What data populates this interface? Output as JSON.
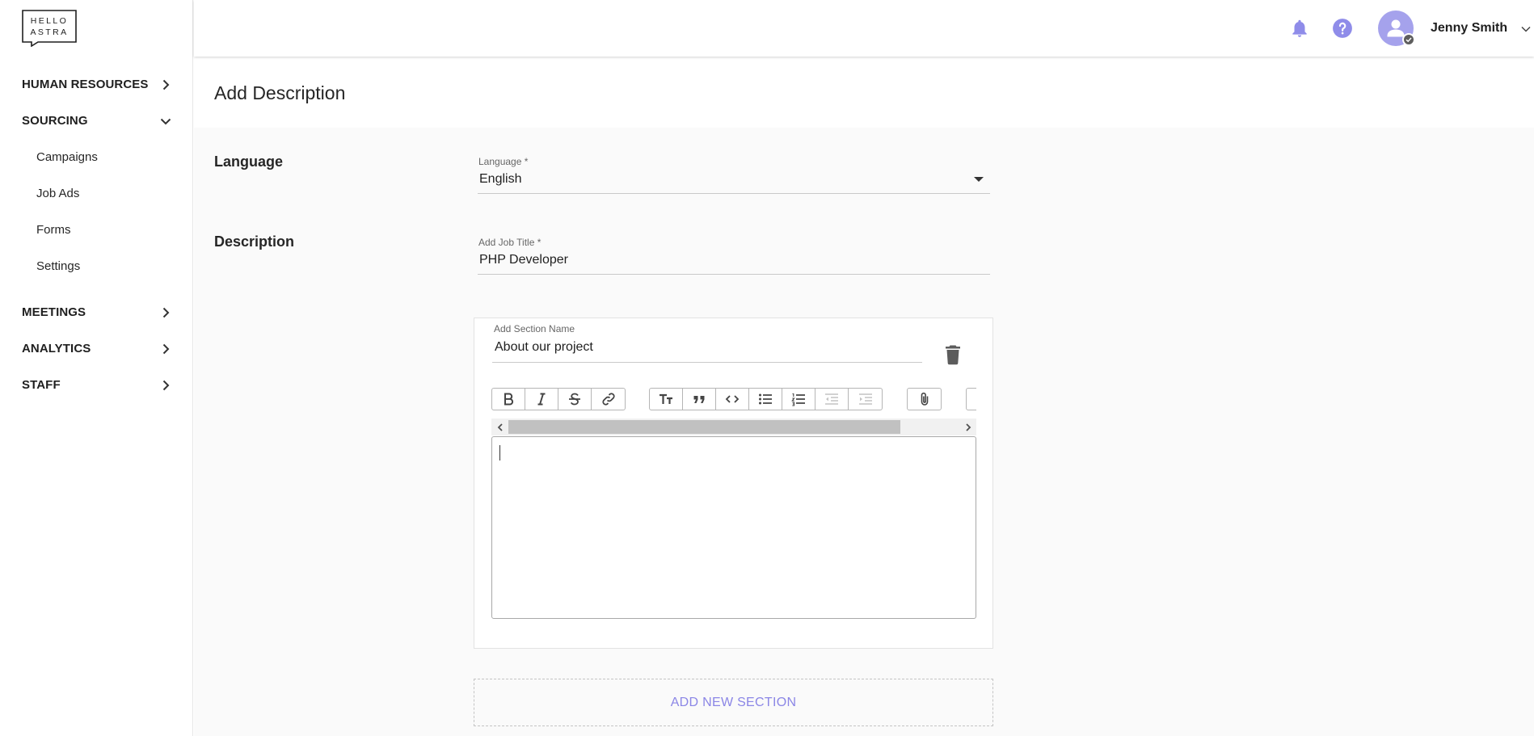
{
  "brand": {
    "logo_line1": "HELLO",
    "logo_line2": "ASTRA"
  },
  "sidebar": {
    "groups": [
      {
        "label": "HUMAN RESOURCES",
        "expanded": false
      },
      {
        "label": "SOURCING",
        "expanded": true,
        "items": [
          "Campaigns",
          "Job Ads",
          "Forms",
          "Settings"
        ]
      },
      {
        "label": "MEETINGS",
        "expanded": false
      },
      {
        "label": "ANALYTICS",
        "expanded": false
      },
      {
        "label": "STAFF",
        "expanded": false
      }
    ]
  },
  "topbar": {
    "icons": [
      "bell-icon",
      "help-icon"
    ],
    "user": {
      "name": "Jenny Smith"
    }
  },
  "page": {
    "title": "Add Description"
  },
  "form": {
    "language_section": "Language",
    "language": {
      "label": "Language *",
      "value": "English"
    },
    "description_section": "Description",
    "job_title": {
      "label": "Add Job Title *",
      "value": "PHP Developer"
    },
    "section": {
      "name_label": "Add Section Name",
      "name_value": "About our project",
      "body": ""
    },
    "add_section_label": "ADD NEW SECTION"
  },
  "colors": {
    "accent": "#8b86e6",
    "accent_icon": "#8f8ce9",
    "avatar": "#a5a2ec",
    "text": "#212121",
    "content_bg": "#fafafa"
  }
}
